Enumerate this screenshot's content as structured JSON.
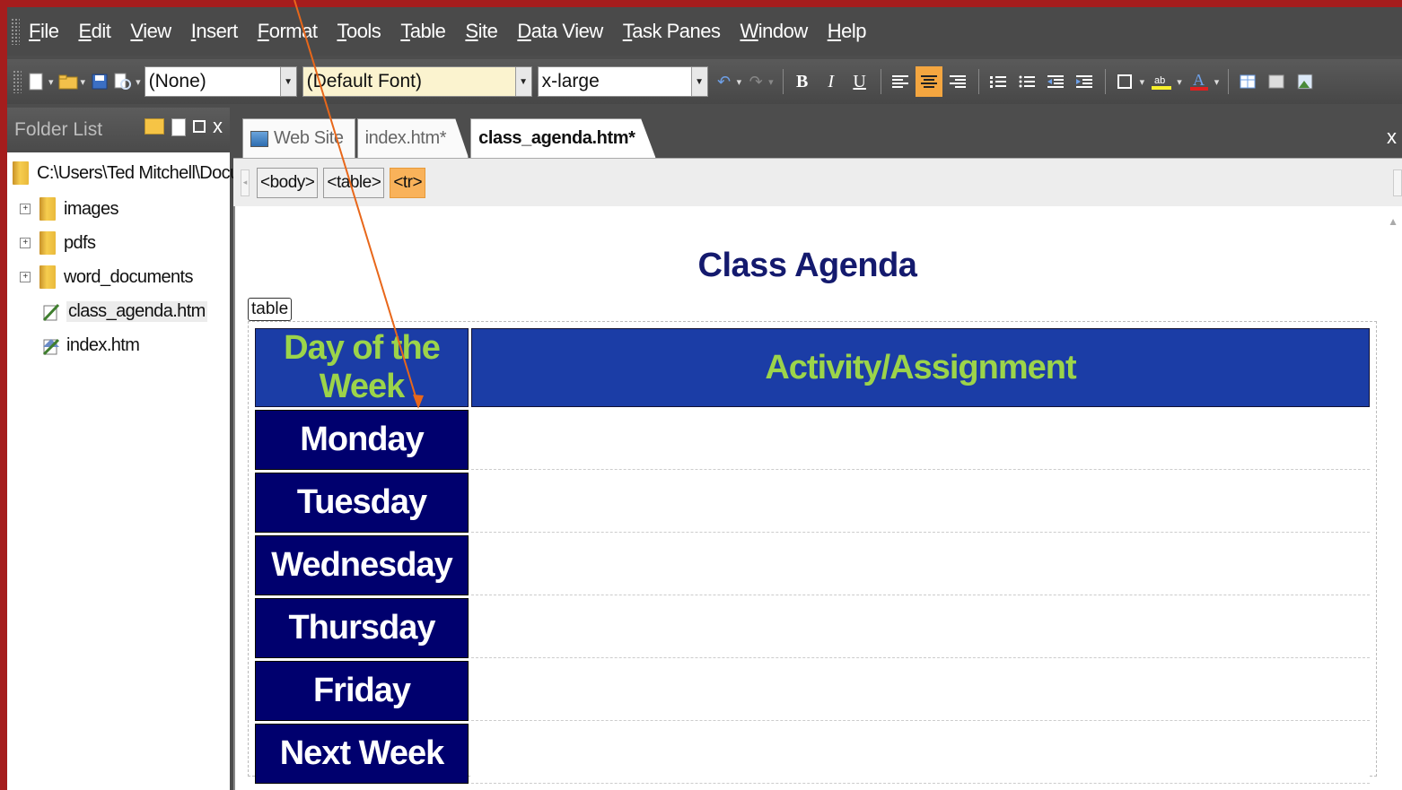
{
  "menu": [
    "File",
    "Edit",
    "View",
    "Insert",
    "Format",
    "Tools",
    "Table",
    "Site",
    "Data View",
    "Task Panes",
    "Window",
    "Help"
  ],
  "toolbar": {
    "style_value": "(None)",
    "font_value": "(Default Font)",
    "size_value": "x-large",
    "bold": "B",
    "italic": "I",
    "underline": "U",
    "align_center_active": true
  },
  "folder_list": {
    "title": "Folder List",
    "root_path": "C:\\Users\\Ted Mitchell\\Docume",
    "items": [
      {
        "label": "images",
        "type": "folder"
      },
      {
        "label": "pdfs",
        "type": "folder"
      },
      {
        "label": "word_documents",
        "type": "folder"
      },
      {
        "label": "class_agenda.htm",
        "type": "file",
        "selected": true
      },
      {
        "label": "index.htm",
        "type": "file"
      }
    ]
  },
  "tabs": [
    {
      "label": "Web Site"
    },
    {
      "label": "index.htm*"
    },
    {
      "label": "class_agenda.htm*",
      "active": true
    }
  ],
  "close_label": "x",
  "quick_tags": [
    "<body>",
    "<table>",
    "<tr>"
  ],
  "page": {
    "title": "Class Agenda",
    "table_tag": "table",
    "headers": [
      "Day of the Week",
      "Activity/Assignment"
    ],
    "days": [
      "Monday",
      "Tuesday",
      "Wednesday",
      "Thursday",
      "Friday",
      "Next Week"
    ]
  },
  "colors": {
    "header_bg": "#1b3da6",
    "header_text": "#9cd44a",
    "day_bg": "#00006e",
    "title": "#141a6e",
    "annotation_arrow": "#e8671a",
    "frame": "#a51d1d"
  }
}
